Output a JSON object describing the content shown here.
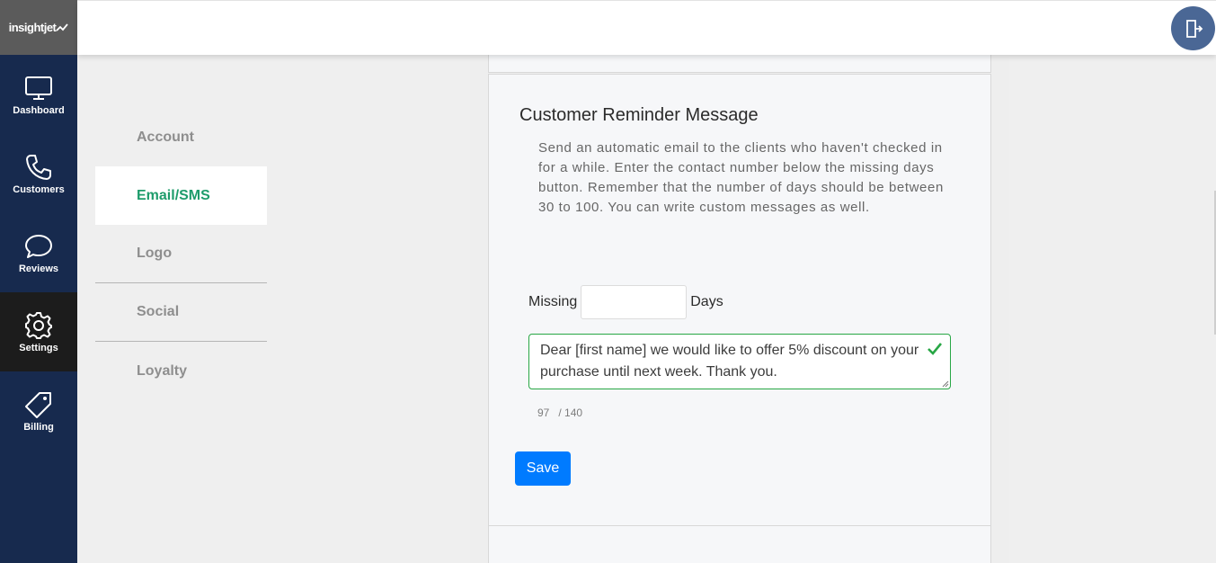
{
  "app": {
    "logo_text": "insightjet"
  },
  "nav": {
    "items": [
      {
        "label": "Dashboard",
        "icon": "monitor-icon"
      },
      {
        "label": "Customers",
        "icon": "phone-icon"
      },
      {
        "label": "Reviews",
        "icon": "chat-bubble-icon"
      },
      {
        "label": "Settings",
        "icon": "gear-icon",
        "active": true
      },
      {
        "label": "Billing",
        "icon": "tag-icon"
      }
    ]
  },
  "topbar": {
    "logout_icon": "logout-icon",
    "accent": "#4a6795"
  },
  "submenu": {
    "items": [
      {
        "label": "Account"
      },
      {
        "label": "Email/SMS",
        "active": true
      },
      {
        "label": "Logo"
      },
      {
        "label": "Social"
      },
      {
        "label": "Loyalty"
      }
    ],
    "active_color": "#1e9c6b"
  },
  "reminder": {
    "title": "Customer Reminder Message",
    "description": "Send an automatic email to the clients who haven't checked in for a while. Enter the contact number below the missing days button. Remember that the number of days should be between 30 to 100. You can write custom messages as well.",
    "missing_label": "Missing",
    "days_label": "Days",
    "days_value": "",
    "message": "Dear [first name] we would like to offer 5% discount on your purchase until next week. Thank you.",
    "char_count": "97",
    "char_limit": "/ 140",
    "save_label": "Save",
    "valid_color": "#28a745",
    "button_color": "#007bff"
  }
}
